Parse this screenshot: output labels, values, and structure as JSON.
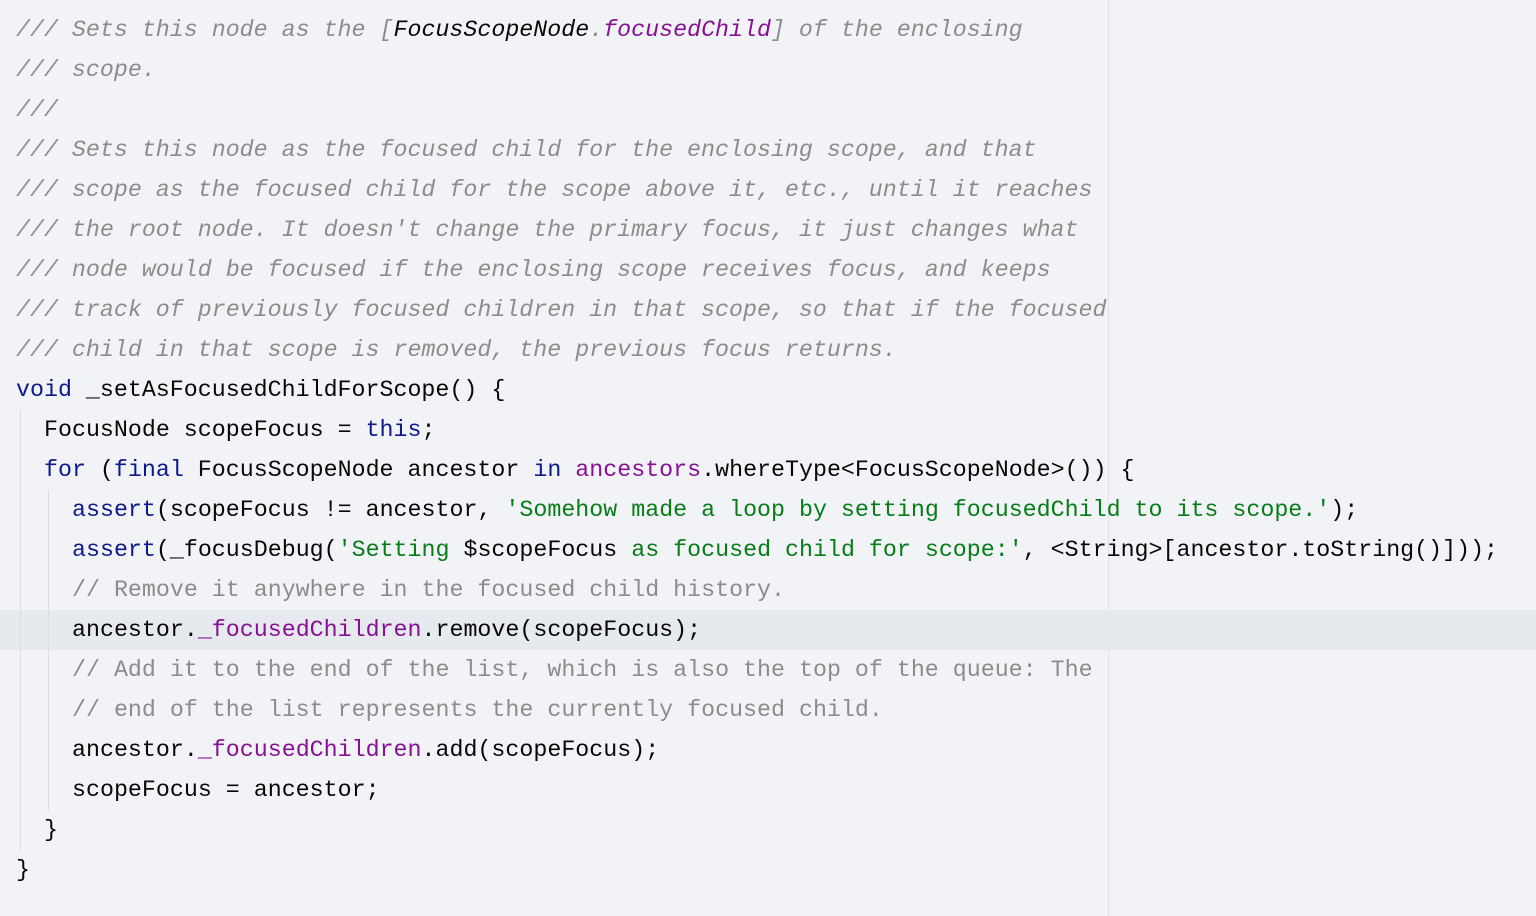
{
  "colors": {
    "background": "#f2f3f7",
    "keyword": "#0a1a8c",
    "string": "#067d17",
    "field": "#871094",
    "comment": "#8c8c8c",
    "current_line": "#e6e9ee"
  },
  "editor": {
    "highlighted_line": 15,
    "lines": [
      {
        "indent": 0,
        "tokens": [
          [
            "c",
            "/// Sets this node as the ["
          ],
          [
            "r",
            "FocusScopeNode"
          ],
          [
            "c",
            "."
          ],
          [
            "rp",
            "focusedChild"
          ],
          [
            "c",
            "] of the enclosing"
          ]
        ]
      },
      {
        "indent": 0,
        "tokens": [
          [
            "c",
            "/// scope."
          ]
        ]
      },
      {
        "indent": 0,
        "tokens": [
          [
            "c",
            "///"
          ]
        ]
      },
      {
        "indent": 0,
        "tokens": [
          [
            "c",
            "/// Sets this node as the focused child for the enclosing scope, and that"
          ]
        ]
      },
      {
        "indent": 0,
        "tokens": [
          [
            "c",
            "/// scope as the focused child for the scope above it, etc., until it reaches"
          ]
        ]
      },
      {
        "indent": 0,
        "tokens": [
          [
            "c",
            "/// the root node. It doesn't change the primary focus, it just changes what"
          ]
        ]
      },
      {
        "indent": 0,
        "tokens": [
          [
            "c",
            "/// node would be focused if the enclosing scope receives focus, and keeps"
          ]
        ]
      },
      {
        "indent": 0,
        "tokens": [
          [
            "c",
            "/// track of previously focused children in that scope, so that if the focused"
          ]
        ]
      },
      {
        "indent": 0,
        "tokens": [
          [
            "c",
            "/// child in that scope is removed, the previous focus returns."
          ]
        ]
      },
      {
        "indent": 0,
        "tokens": [
          [
            "k",
            "void"
          ],
          [
            "p",
            " _setAsFocusedChildForScope() {"
          ]
        ]
      },
      {
        "indent": 1,
        "tokens": [
          [
            "p",
            "FocusNode scopeFocus = "
          ],
          [
            "k",
            "this"
          ],
          [
            "p",
            ";"
          ]
        ]
      },
      {
        "indent": 1,
        "tokens": [
          [
            "k",
            "for"
          ],
          [
            "p",
            " ("
          ],
          [
            "k",
            "final"
          ],
          [
            "p",
            " FocusScopeNode ancestor "
          ],
          [
            "k",
            "in"
          ],
          [
            "p",
            " "
          ],
          [
            "f",
            "ancestors"
          ],
          [
            "p",
            ".whereType<FocusScopeNode>()) {"
          ]
        ]
      },
      {
        "indent": 2,
        "tokens": [
          [
            "k",
            "assert"
          ],
          [
            "p",
            "(scopeFocus != ancestor, "
          ],
          [
            "s",
            "'Somehow made a loop by setting focusedChild to its scope.'"
          ],
          [
            "p",
            ");"
          ]
        ]
      },
      {
        "indent": 2,
        "tokens": [
          [
            "k",
            "assert"
          ],
          [
            "p",
            "(_focusDebug("
          ],
          [
            "s",
            "'Setting "
          ],
          [
            "p",
            "$scopeFocus"
          ],
          [
            "s",
            " as focused child for scope:'"
          ],
          [
            "p",
            ", <String>[ancestor.toString()]));"
          ]
        ]
      },
      {
        "indent": 2,
        "tokens": [
          [
            "lc",
            "// Remove it anywhere in the focused child history."
          ]
        ]
      },
      {
        "indent": 2,
        "tokens": [
          [
            "p",
            "ancestor."
          ],
          [
            "f",
            "_focusedChildren"
          ],
          [
            "p",
            ".remove(scopeFocus);"
          ]
        ]
      },
      {
        "indent": 2,
        "tokens": [
          [
            "lc",
            "// Add it to the end of the list, which is also the top of the queue: The"
          ]
        ]
      },
      {
        "indent": 2,
        "tokens": [
          [
            "lc",
            "// end of the list represents the currently focused child."
          ]
        ]
      },
      {
        "indent": 2,
        "tokens": [
          [
            "p",
            "ancestor."
          ],
          [
            "f",
            "_focusedChildren"
          ],
          [
            "p",
            ".add(scopeFocus);"
          ]
        ]
      },
      {
        "indent": 2,
        "tokens": [
          [
            "p",
            "scopeFocus = ancestor;"
          ]
        ]
      },
      {
        "indent": 1,
        "tokens": [
          [
            "p",
            "}"
          ]
        ]
      },
      {
        "indent": 0,
        "tokens": [
          [
            "p",
            "}"
          ]
        ]
      }
    ]
  }
}
